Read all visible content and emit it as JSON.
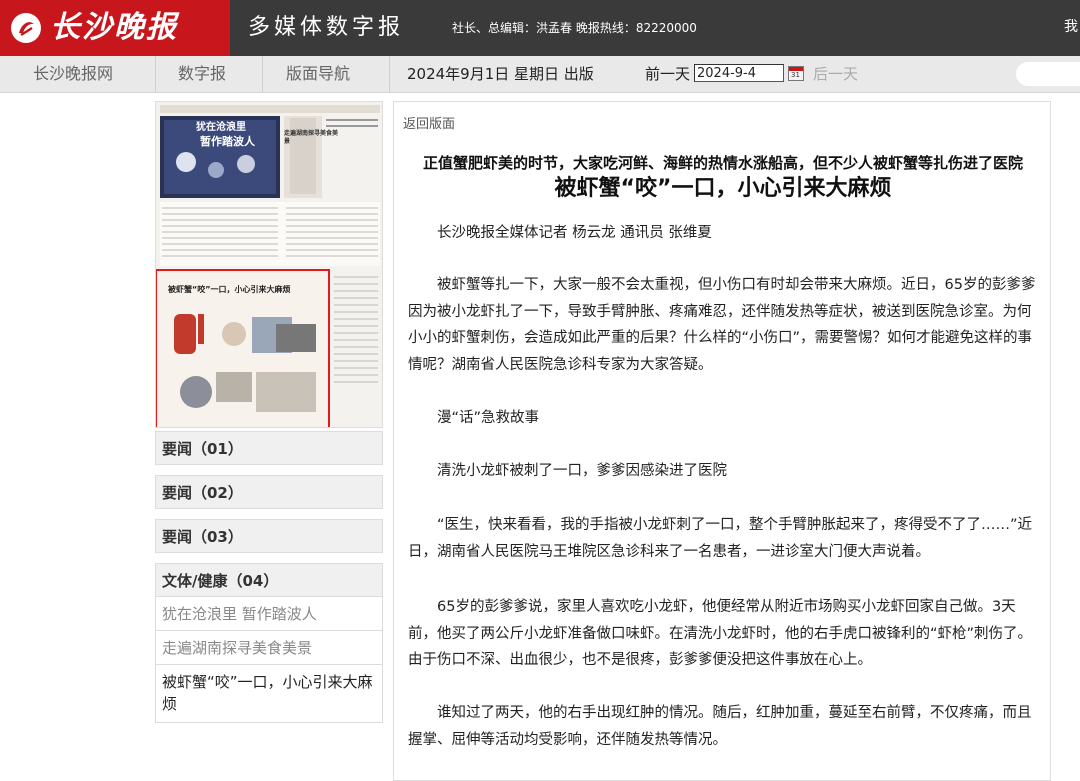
{
  "header": {
    "logo_text": "长沙晚报",
    "site_title": "多媒体数字报",
    "editor_info": "社长、总编辑：洪孟春 晚报热线：82220000",
    "right_text": "我"
  },
  "nav": {
    "items": [
      "长沙晚报网",
      "数字报",
      "版面导航"
    ],
    "date_text": "2024年9月1日 星期日 出版",
    "prev_day": "前一天",
    "date_value": "2024-9-4",
    "next_day": "后一天",
    "calendar_day": "31"
  },
  "sidebar": {
    "sections": [
      {
        "label": "要闻（01）"
      },
      {
        "label": "要闻（02）"
      },
      {
        "label": "要闻（03）"
      },
      {
        "label": "文体/健康（04）"
      }
    ],
    "articles": [
      {
        "label": "犹在沧浪里 暂作踏波人"
      },
      {
        "label": "走遍湖南探寻美食美景"
      },
      {
        "label": "被虾蟹“咬”一口，小心引来大麻烦"
      }
    ]
  },
  "thumbnail": {
    "top_headline_1": "犹在沧浪里",
    "top_headline_2": "暂作踏波人",
    "right_headline": "走遍湖南探寻美食美景",
    "lower_headline": "被虾蟹“咬”一口，小心引来大麻烦"
  },
  "article": {
    "back_label": "返回版面",
    "subtitle": "正值蟹肥虾美的时节，大家吃河鲜、海鲜的热情水涨船高，但不少人被虾蟹等扎伤进了医院",
    "headline": "被虾蟹“咬”一口，小心引来大麻烦",
    "byline": "长沙晚报全媒体记者 杨云龙 通讯员 张维夏",
    "paragraphs": [
      "被虾蟹等扎一下，大家一般不会太重视，但小伤口有时却会带来大麻烦。近日，65岁的彭爹爹因为被小龙虾扎了一下，导致手臂肿胀、疼痛难忍，还伴随发热等症状，被送到医院急诊室。为何小小的虾蟹刺伤，会造成如此严重的后果？什么样的“小伤口”，需要警惕？如何才能避免这样的事情呢？湖南省人民医院急诊科专家为大家答疑。",
      "漫“话”急救故事",
      "清洗小龙虾被刺了一口，爹爹因感染进了医院",
      "“医生，快来看看，我的手指被小龙虾刺了一口，整个手臂肿胀起来了，疼得受不了了……”近日，湖南省人民医院马王堆院区急诊科来了一名患者，一进诊室大门便大声说着。",
      "65岁的彭爹爹说，家里人喜欢吃小龙虾，他便经常从附近市场购买小龙虾回家自己做。3天前，他买了两公斤小龙虾准备做口味虾。在清洗小龙虾时，他的右手虎口被锋利的“虾枪”刺伤了。由于伤口不深、出血很少，也不是很疼，彭爹爹便没把这件事放在心上。",
      "谁知过了两天，他的右手出现红肿的情况。随后，红肿加重，蔓延至右前臂，不仅疼痛，而且握掌、屈伸等活动均受影响，还伴随发热等情况。"
    ]
  },
  "colors": {
    "brand_red": "#c8161d",
    "topbar_bg": "#3a3a3a",
    "navbar_bg": "#e9e9e9"
  }
}
